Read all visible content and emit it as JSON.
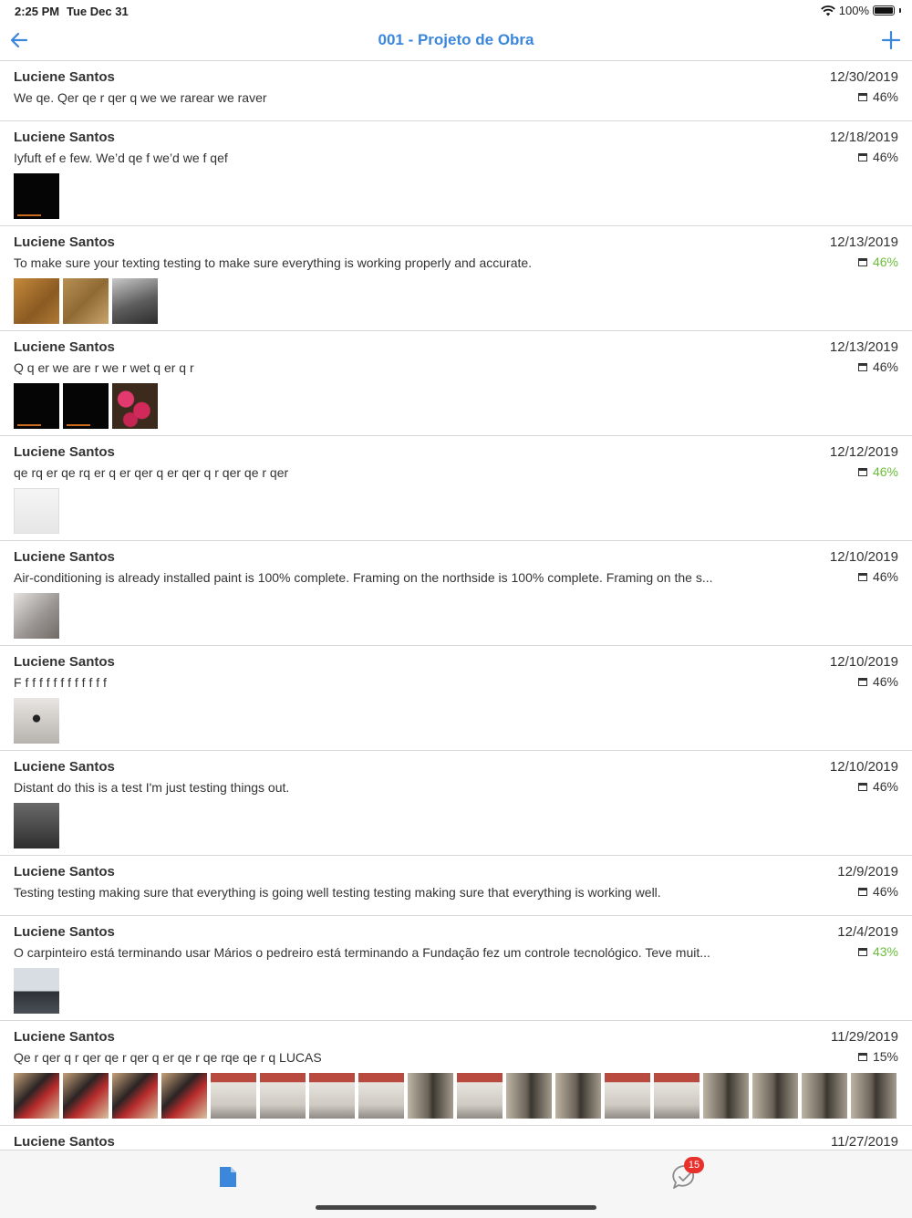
{
  "status_bar": {
    "time": "2:25 PM",
    "date": "Tue Dec 31",
    "battery": "100%"
  },
  "nav": {
    "title": "001 - Projeto de Obra",
    "back_icon": "arrow-left-icon",
    "add_icon": "plus-icon"
  },
  "colors": {
    "accent": "#3b87dc",
    "progress_green": "#6bbd3a",
    "badge_red": "#e8302c"
  },
  "entries": [
    {
      "author": "Luciene Santos",
      "message": "We qe. Qer qe r qer q we we rarear we raver",
      "date": "12/30/2019",
      "progress": "46%"
    },
    {
      "author": "Luciene Santos",
      "message": "Iyfuft ef e few. We’d qe f we’d we f qef",
      "date": "12/18/2019",
      "progress": "46%"
    },
    {
      "author": "Luciene Santos",
      "message": "To make sure your texting testing to make sure everything is working properly and accurate.",
      "date": "12/13/2019",
      "progress": "46%"
    },
    {
      "author": "Luciene Santos",
      "message": "Q q er we are r we r wet q er q r",
      "date": "12/13/2019",
      "progress": "46%"
    },
    {
      "author": "Luciene Santos",
      "message": "qe rq er qe rq er q er qer q er qer q r qer qe r qer",
      "date": "12/12/2019",
      "progress": "46%"
    },
    {
      "author": "Luciene Santos",
      "message": "Air-conditioning is already installed paint is 100% complete. Framing on the northside is 100% complete. Framing on the s...",
      "date": "12/10/2019",
      "progress": "46%"
    },
    {
      "author": "Luciene Santos",
      "message": "F f f f f f f f f f f f f",
      "date": "12/10/2019",
      "progress": "46%"
    },
    {
      "author": "Luciene Santos",
      "message": "Distant do this is a test I'm just testing things out.",
      "date": "12/10/2019",
      "progress": "46%"
    },
    {
      "author": "Luciene Santos",
      "message": "Testing testing making sure that everything is going well testing testing making sure that everything is working well.",
      "date": "12/9/2019",
      "progress": "46%"
    },
    {
      "author": "Luciene Santos",
      "message": "O carpinteiro está terminando usar Mários o pedreiro está terminando a Fundação fez um controle tecnológico. Teve muit...",
      "date": "12/4/2019",
      "progress": "43%"
    },
    {
      "author": "Luciene Santos",
      "message": "Qe r qer q r qer qe r qer q er qe r qe rqe qe r q LUCAS",
      "date": "11/29/2019",
      "progress": "15%"
    },
    {
      "author": "Luciene Santos",
      "date": "11/27/2019"
    }
  ],
  "tab_bar": {
    "documents_icon": "document-icon",
    "messages_icon": "chat-check-icon",
    "badge_count": "15"
  }
}
